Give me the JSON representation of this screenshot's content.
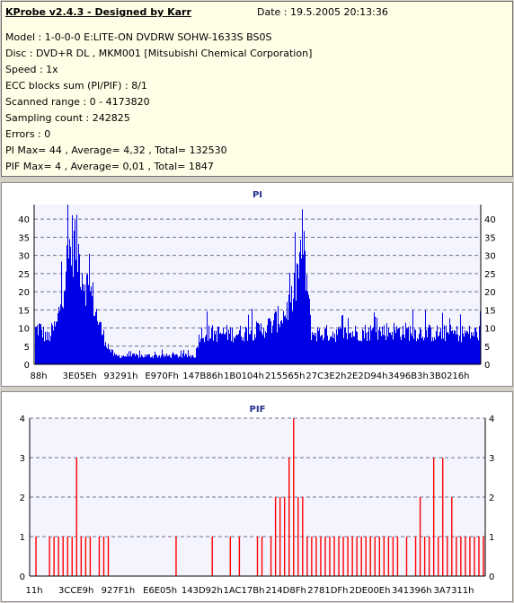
{
  "header": {
    "app_title": "KProbe v2.4.3 - Designed by Karr",
    "date": "Date : 19.5.2005 20:13:36"
  },
  "info": {
    "model": "Model : 1-0-0-0 E:LITE-ON DVDRW SOHW-1633S BS0S",
    "disc": "Disc : DVD+R DL , MKM001 [Mitsubishi Chemical Corporation]",
    "speed": "Speed : 1x",
    "ecc": "ECC blocks sum (PI/PIF) : 8/1",
    "range": "Scanned range : 0 - 4173820",
    "sampling": "Sampling count : 242825",
    "errors": "Errors : 0",
    "pi_stats": "PI Max= 44 , Average= 4,32 , Total= 132530",
    "pif_stats": "PIF Max= 4 , Average= 0,01 , Total= 1847"
  },
  "colors": {
    "pi_fill": "#0000e6",
    "pif_bar": "#ff0000",
    "plot_bg": "#f4f4ff",
    "grid": "#6e6e8e",
    "title": "#1f2c8c"
  },
  "chart_data": [
    {
      "type": "bar",
      "title": "PI",
      "y_ticks": [
        0,
        5,
        10,
        15,
        20,
        25,
        30,
        35,
        40
      ],
      "ylim": [
        0,
        44
      ],
      "x_tick_labels": [
        "88h",
        "3E05Eh",
        "93291h",
        "E970Fh",
        "147B86h",
        "1B0104h",
        "215565h",
        "27C3E2h",
        "2E2D94h",
        "3496B3h",
        "3B0216h"
      ],
      "grid": true,
      "envelope": [
        [
          0,
          12
        ],
        [
          1,
          13
        ],
        [
          2,
          11
        ],
        [
          3,
          9
        ],
        [
          4,
          12
        ],
        [
          5,
          14
        ],
        [
          6,
          24
        ],
        [
          7,
          33
        ],
        [
          8,
          42
        ],
        [
          9,
          44
        ],
        [
          10,
          38
        ],
        [
          11,
          31
        ],
        [
          12,
          27
        ],
        [
          13,
          24
        ],
        [
          14,
          17
        ],
        [
          15,
          12
        ],
        [
          16,
          8
        ],
        [
          17,
          5
        ],
        [
          18,
          3
        ],
        [
          36,
          3
        ],
        [
          37,
          11
        ],
        [
          46,
          11
        ],
        [
          50,
          12
        ],
        [
          53,
          14
        ],
        [
          56,
          18
        ],
        [
          58,
          24
        ],
        [
          59,
          33
        ],
        [
          60,
          44
        ],
        [
          61,
          29
        ],
        [
          62,
          11
        ],
        [
          70,
          11
        ],
        [
          80,
          12
        ],
        [
          90,
          11
        ],
        [
          100,
          11
        ]
      ]
    },
    {
      "type": "bar",
      "title": "PIF",
      "y_ticks": [
        0,
        1,
        2,
        3,
        4
      ],
      "ylim": [
        0,
        4
      ],
      "x_tick_labels": [
        "11h",
        "3CCE9h",
        "927F1h",
        "E6E05h",
        "143D92h",
        "1AC17Bh",
        "214D8Fh",
        "2781DFh",
        "2DE00Eh",
        "341396h",
        "3A7311h"
      ],
      "grid": true,
      "spikes": [
        [
          1,
          1
        ],
        [
          4,
          1
        ],
        [
          5,
          1
        ],
        [
          6,
          1
        ],
        [
          7,
          1
        ],
        [
          8,
          1
        ],
        [
          9,
          1
        ],
        [
          10,
          3
        ],
        [
          11,
          1
        ],
        [
          12,
          1
        ],
        [
          13,
          1
        ],
        [
          15,
          1
        ],
        [
          16,
          1
        ],
        [
          17,
          1
        ],
        [
          32,
          1
        ],
        [
          40,
          1
        ],
        [
          44,
          1
        ],
        [
          46,
          1
        ],
        [
          50,
          1
        ],
        [
          51,
          1
        ],
        [
          53,
          1
        ],
        [
          54,
          2
        ],
        [
          55,
          2
        ],
        [
          56,
          2
        ],
        [
          57,
          3
        ],
        [
          58,
          4
        ],
        [
          59,
          2
        ],
        [
          60,
          2
        ],
        [
          61,
          1
        ],
        [
          62,
          1
        ],
        [
          63,
          1
        ],
        [
          64,
          1
        ],
        [
          65,
          1
        ],
        [
          66,
          1
        ],
        [
          67,
          1
        ],
        [
          68,
          1
        ],
        [
          69,
          1
        ],
        [
          70,
          1
        ],
        [
          71,
          1
        ],
        [
          72,
          1
        ],
        [
          73,
          1
        ],
        [
          74,
          1
        ],
        [
          75,
          1
        ],
        [
          76,
          1
        ],
        [
          77,
          1
        ],
        [
          78,
          1
        ],
        [
          79,
          1
        ],
        [
          80,
          1
        ],
        [
          81,
          1
        ],
        [
          83,
          1
        ],
        [
          85,
          1
        ],
        [
          86,
          2
        ],
        [
          87,
          1
        ],
        [
          88,
          1
        ],
        [
          89,
          3
        ],
        [
          90,
          1
        ],
        [
          91,
          3
        ],
        [
          92,
          1
        ],
        [
          93,
          2
        ],
        [
          94,
          1
        ],
        [
          95,
          1
        ],
        [
          96,
          1
        ],
        [
          97,
          1
        ],
        [
          98,
          1
        ],
        [
          99,
          1
        ],
        [
          100,
          1
        ]
      ]
    }
  ]
}
